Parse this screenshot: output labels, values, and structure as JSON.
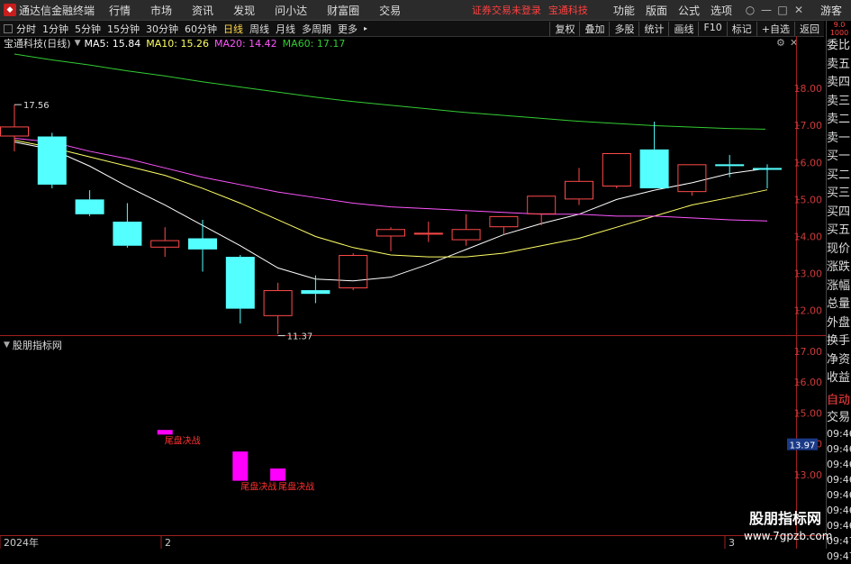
{
  "app": {
    "title": "通达信金融终端",
    "menus": [
      "行情",
      "市场",
      "资讯",
      "发现",
      "问小达",
      "财富圈",
      "交易"
    ],
    "warning": "证券交易未登录",
    "stock_name": "宝通科技",
    "right_menus": [
      "功能",
      "版面",
      "公式",
      "选项"
    ],
    "guest": "游客",
    "window_controls": [
      "○",
      "—",
      "□",
      "✕"
    ]
  },
  "toolbar": {
    "periods": [
      "分时",
      "1分钟",
      "5分钟",
      "15分钟",
      "30分钟",
      "60分钟",
      "日线",
      "周线",
      "月线",
      "多周期",
      "更多"
    ],
    "active_period": "日线",
    "right_buttons": [
      "复权",
      "叠加",
      "多股",
      "统计",
      "画线",
      "F10",
      "标记",
      "+自选",
      "返回"
    ]
  },
  "main_chart": {
    "title": "宝通科技(日线)",
    "ma_labels": [
      {
        "text": "MA5: 15.84",
        "color": "#ffffff"
      },
      {
        "text": "MA10: 15.26",
        "color": "#ffff66"
      },
      {
        "text": "MA20: 14.42",
        "color": "#ff55ff"
      },
      {
        "text": "MA60: 17.17",
        "color": "#33cc33"
      }
    ],
    "high_label": "17.56",
    "low_label": "11.37",
    "y_ticks": [
      "18.00",
      "17.00",
      "16.00",
      "15.00",
      "14.00",
      "13.00",
      "12.00"
    ]
  },
  "sub_chart": {
    "title": "股朋指标网",
    "y_ticks": [
      "17.00",
      "16.00",
      "15.00",
      "14.00",
      "13.00"
    ],
    "price_tag": "13.97",
    "signal_label": "尾盘决战"
  },
  "x_axis": {
    "labels": [
      "2024年",
      "2",
      "3"
    ]
  },
  "right_panel": {
    "header": "9.0 1000",
    "rows": [
      "委比",
      "卖五",
      "卖四",
      "卖三",
      "卖二",
      "卖一",
      "买一",
      "买二",
      "买三",
      "买四",
      "买五",
      "现价",
      "涨跌",
      "涨幅",
      "总量",
      "外盘",
      "换手",
      "净资",
      "收益"
    ],
    "auto": "自动",
    "trade": "交易",
    "times": [
      "09:46",
      "09:46",
      "09:46",
      "09:46",
      "09:46",
      "09:46",
      "09:46",
      "09:47",
      "09:47"
    ]
  },
  "watermark": {
    "line1": "股朋指标网",
    "line2": "www.7gpzb.com"
  },
  "colors": {
    "up": "#ff4a4a",
    "down": "#54ffff",
    "ma5": "#ffffff",
    "ma10": "#ffff66",
    "ma20": "#ff55ff",
    "ma60": "#33cc33",
    "signal": "#ff00ff",
    "label": "#ff3030"
  },
  "chart_data": {
    "type": "candlestick",
    "title": "宝通科技(日线)",
    "ylim": [
      11.3,
      18.2
    ],
    "candles": [
      {
        "open": 16.7,
        "close": 16.97,
        "high": 17.56,
        "low": 16.3
      },
      {
        "open": 16.7,
        "close": 15.4,
        "high": 16.8,
        "low": 15.3
      },
      {
        "open": 15.0,
        "close": 14.6,
        "high": 15.25,
        "low": 14.55
      },
      {
        "open": 14.4,
        "close": 13.75,
        "high": 14.9,
        "low": 13.7
      },
      {
        "open": 13.7,
        "close": 13.9,
        "high": 14.25,
        "low": 13.45
      },
      {
        "open": 13.95,
        "close": 13.65,
        "high": 14.45,
        "low": 13.05
      },
      {
        "open": 13.45,
        "close": 12.05,
        "high": 13.5,
        "low": 11.65
      },
      {
        "open": 11.85,
        "close": 12.55,
        "high": 12.75,
        "low": 11.37
      },
      {
        "open": 12.55,
        "close": 12.45,
        "high": 12.95,
        "low": 12.2
      },
      {
        "open": 12.6,
        "close": 13.5,
        "high": 13.55,
        "low": 12.55
      },
      {
        "open": 14.0,
        "close": 14.2,
        "high": 14.25,
        "low": 13.6
      },
      {
        "open": 14.05,
        "close": 14.1,
        "high": 14.4,
        "low": 13.85
      },
      {
        "open": 13.9,
        "close": 14.2,
        "high": 14.6,
        "low": 13.75
      },
      {
        "open": 14.25,
        "close": 14.55,
        "high": 14.55,
        "low": 14.05
      },
      {
        "open": 14.6,
        "close": 15.1,
        "high": 15.1,
        "low": 14.3
      },
      {
        "open": 15.0,
        "close": 15.5,
        "high": 15.85,
        "low": 14.85
      },
      {
        "open": 15.35,
        "close": 16.25,
        "high": 16.25,
        "low": 15.3
      },
      {
        "open": 16.35,
        "close": 15.3,
        "high": 17.1,
        "low": 15.3
      },
      {
        "open": 15.2,
        "close": 15.95,
        "high": 15.95,
        "low": 15.1
      },
      {
        "open": 15.95,
        "close": 15.9,
        "high": 16.2,
        "low": 15.6
      },
      {
        "open": 15.85,
        "close": 15.8,
        "high": 15.95,
        "low": 15.3
      }
    ],
    "series": [
      {
        "name": "MA5",
        "values": [
          16.55,
          16.35,
          15.9,
          15.35,
          14.85,
          14.3,
          13.75,
          13.15,
          12.85,
          12.8,
          12.9,
          13.25,
          13.65,
          14.05,
          14.35,
          14.6,
          15.0,
          15.25,
          15.45,
          15.7,
          15.84
        ]
      },
      {
        "name": "MA10",
        "values": [
          16.6,
          16.4,
          16.15,
          15.9,
          15.65,
          15.3,
          14.9,
          14.45,
          14.0,
          13.7,
          13.5,
          13.45,
          13.45,
          13.55,
          13.75,
          13.95,
          14.25,
          14.55,
          14.85,
          15.05,
          15.26
        ]
      },
      {
        "name": "MA20",
        "values": [
          16.65,
          16.55,
          16.3,
          16.1,
          15.85,
          15.6,
          15.4,
          15.2,
          15.05,
          14.9,
          14.8,
          14.75,
          14.7,
          14.65,
          14.6,
          14.6,
          14.55,
          14.55,
          14.5,
          14.45,
          14.42
        ]
      },
      {
        "name": "MA60",
        "values": [
          18.2,
          18.12,
          18.05,
          17.97,
          17.9,
          17.82,
          17.75,
          17.68,
          17.61,
          17.55,
          17.5,
          17.45,
          17.4,
          17.36,
          17.32,
          17.28,
          17.25,
          17.22,
          17.2,
          17.18,
          17.17
        ]
      }
    ],
    "signals": [
      {
        "index": 4,
        "top": 14.45,
        "bottom": 14.3
      },
      {
        "index": 6,
        "top": 13.75,
        "bottom": 12.8
      },
      {
        "index": 7,
        "top": 13.2,
        "bottom": 12.8
      }
    ]
  }
}
